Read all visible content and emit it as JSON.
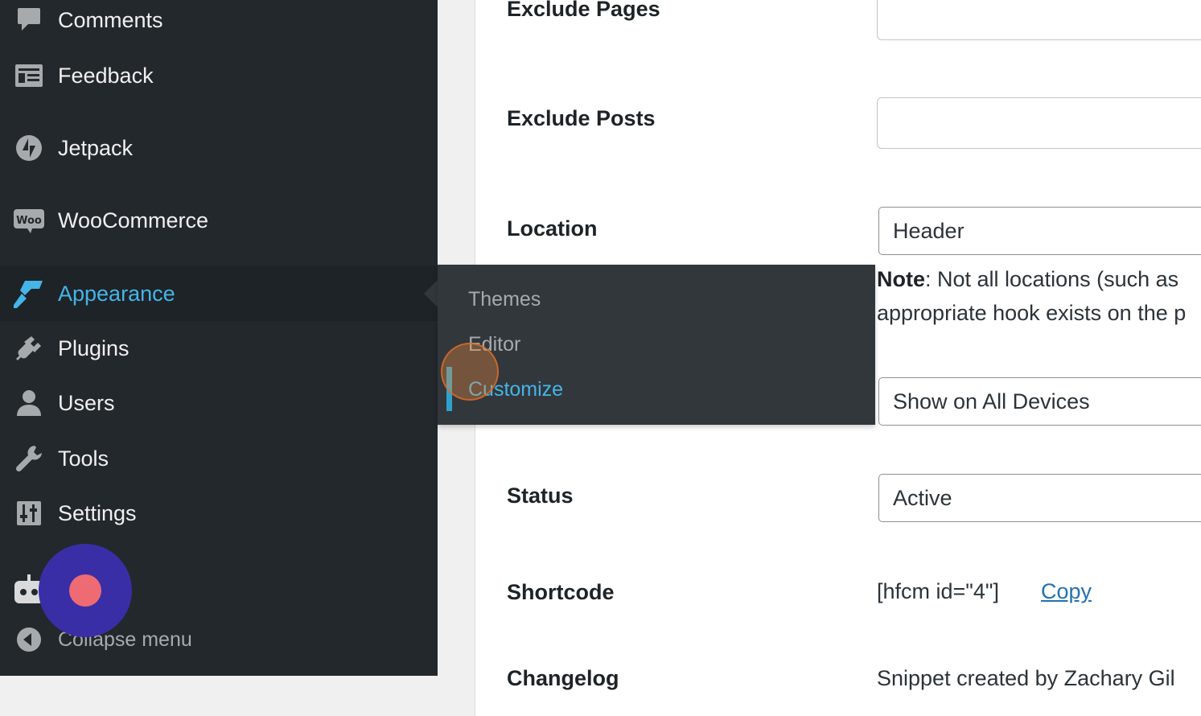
{
  "sidebar": {
    "items": [
      {
        "label": "Comments",
        "icon": "comment-icon"
      },
      {
        "label": "Feedback",
        "icon": "feedback-icon"
      },
      {
        "label": "Jetpack",
        "icon": "jetpack-icon"
      },
      {
        "label": "WooCommerce",
        "icon": "woocommerce-icon"
      },
      {
        "label": "Appearance",
        "icon": "paintbrush-icon",
        "active": true
      },
      {
        "label": "Plugins",
        "icon": "plugin-icon"
      },
      {
        "label": "Users",
        "icon": "users-icon"
      },
      {
        "label": "Tools",
        "icon": "wrench-icon"
      },
      {
        "label": "Settings",
        "icon": "settings-icon"
      }
    ],
    "collapse_label": "Collapse menu",
    "accent_color": "#45b4e7"
  },
  "flyout": {
    "items": [
      {
        "label": "Themes"
      },
      {
        "label": "Editor"
      },
      {
        "label": "Customize",
        "current": true
      }
    ]
  },
  "form": {
    "exclude_pages_label": "Exclude Pages",
    "exclude_posts_label": "Exclude Posts",
    "location_label": "Location",
    "location_value": "Header",
    "note_bold": "Note",
    "note_line1": ": Not all locations (such as",
    "note_line2": "appropriate hook exists on the p",
    "device_value": "Show on All Devices",
    "status_label": "Status",
    "status_value": "Active",
    "shortcode_label": "Shortcode",
    "shortcode_value": "[hfcm id=\"4\"]",
    "copy_label": "Copy",
    "bottom_left_cut": "Changelog",
    "bottom_right_cut": "Snippet created by Zachary Gil"
  }
}
